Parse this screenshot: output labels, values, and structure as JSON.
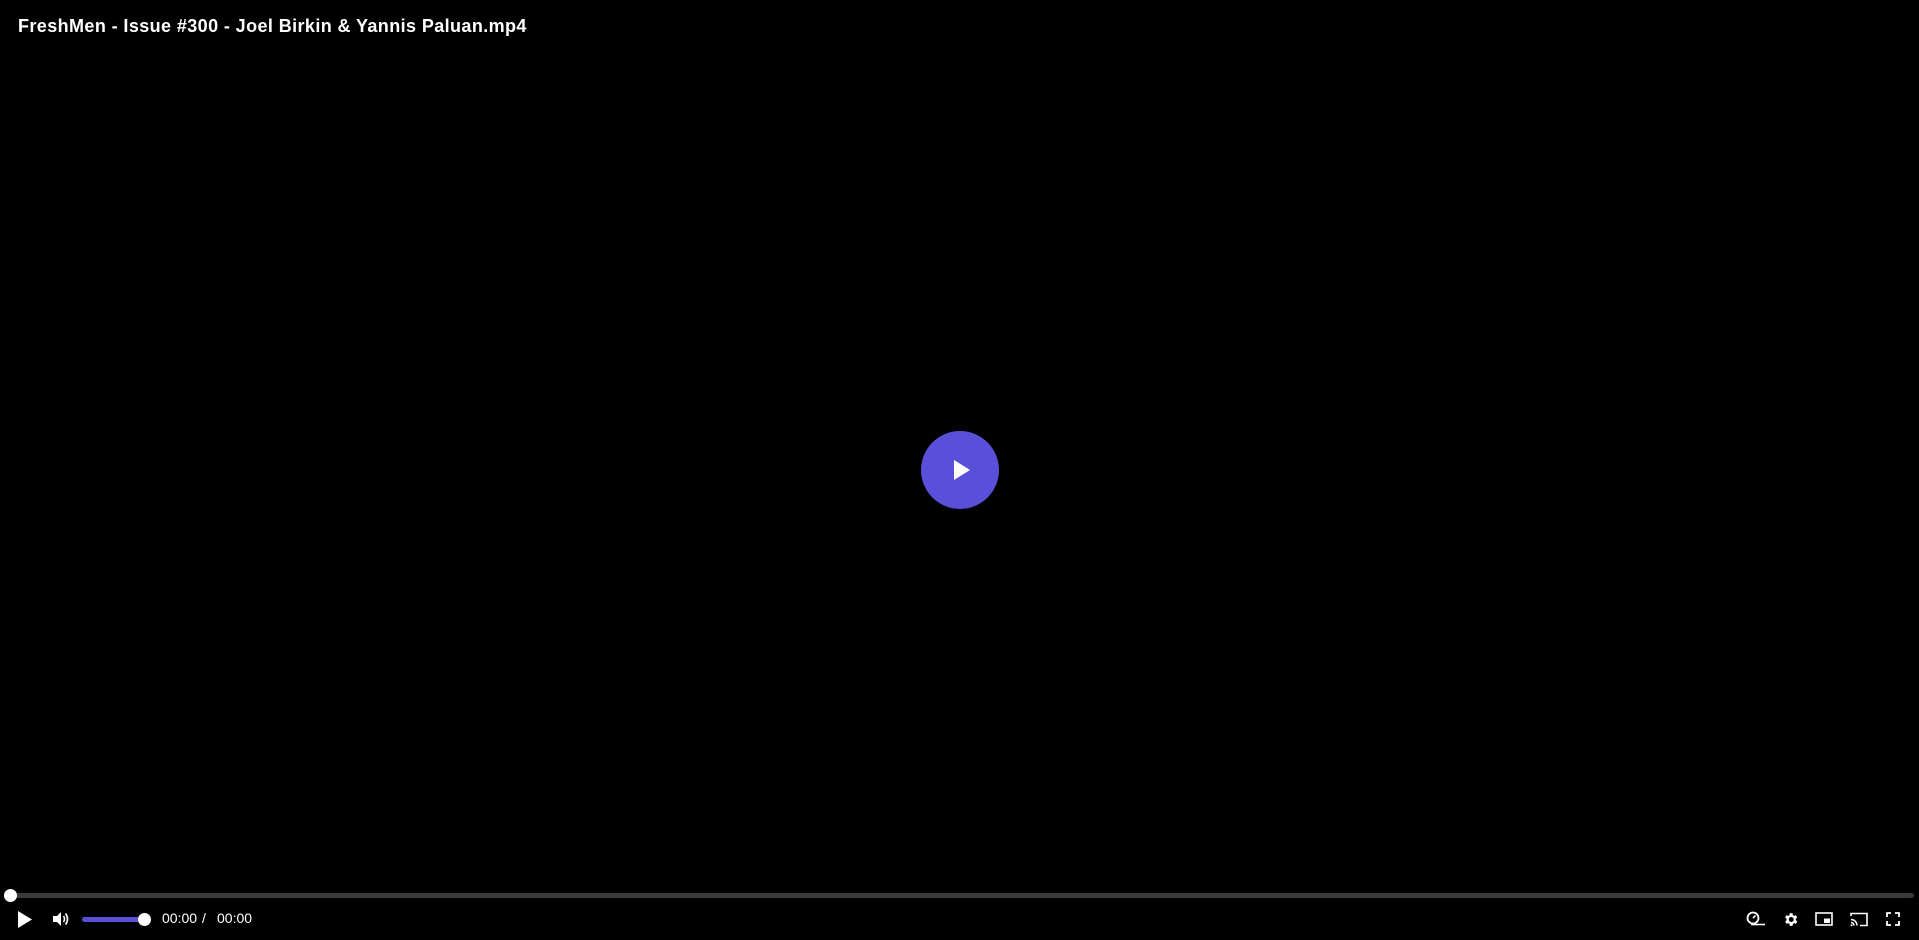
{
  "player": {
    "title": "FreshMen - Issue #300 - Joel Birkin & Yannis Paluan.mp4",
    "accent_color": "#5a4fd8",
    "background_color": "#000000"
  },
  "progress": {
    "played_fraction": 0.0
  },
  "volume": {
    "level_fraction": 1.0
  },
  "time": {
    "current": "00:00",
    "separator": "/",
    "duration": "00:00"
  },
  "icons": {
    "big_play": "play-icon",
    "play": "play-icon",
    "volume": "volume-icon",
    "speed": "playback-speed-icon",
    "settings": "gear-icon",
    "pip": "picture-in-picture-icon",
    "cast": "cast-icon",
    "fullscreen": "fullscreen-icon"
  }
}
